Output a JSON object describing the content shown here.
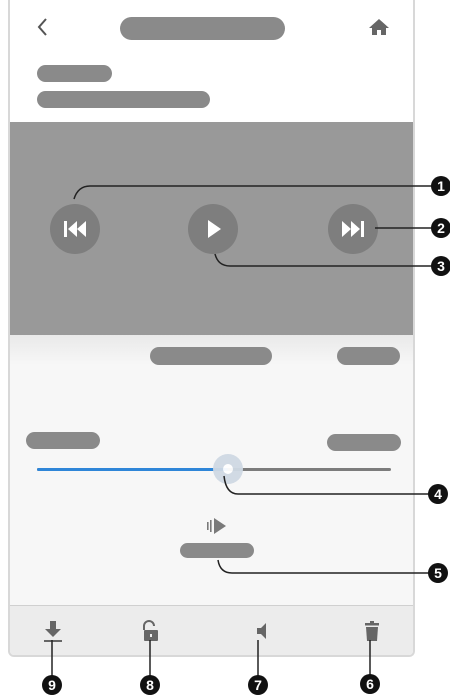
{
  "header": {
    "back_icon": "chevron-left-icon",
    "home_icon": "home-icon"
  },
  "player": {
    "controls": [
      "previous-track-icon",
      "play-icon",
      "next-track-icon"
    ],
    "progress": 0.54
  },
  "bottom_bar": [
    "download-icon",
    "unlock-icon",
    "volume-icon",
    "trash-icon"
  ],
  "callouts": {
    "c1": "1",
    "c2": "2",
    "c3": "3",
    "c4": "4",
    "c5": "5",
    "c6": "6",
    "c7": "7",
    "c8": "8",
    "c9": "9"
  },
  "colors": {
    "accent": "#2f86d8",
    "placeholder": "#8a8a8a",
    "video_bg": "#999999"
  }
}
